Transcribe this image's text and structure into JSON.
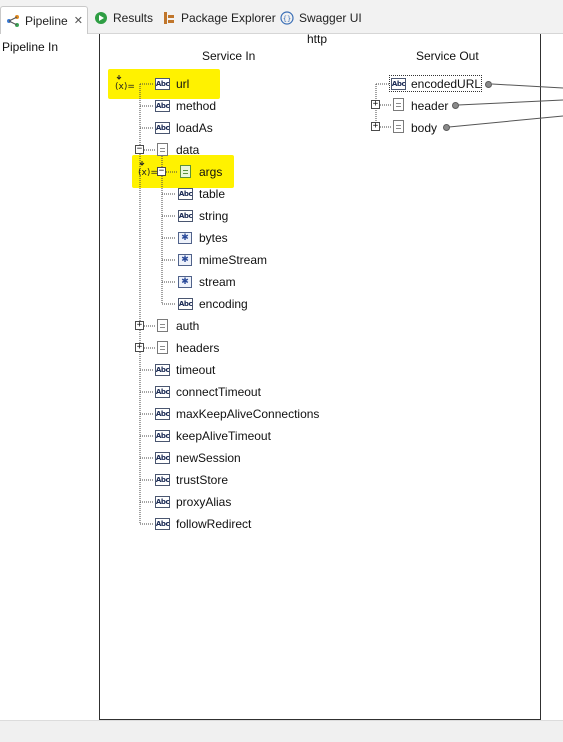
{
  "tabs": [
    {
      "label": "Pipeline",
      "icon": "pipeline-icon",
      "active": true,
      "closable": true
    },
    {
      "label": "Results",
      "icon": "results-icon",
      "active": false
    },
    {
      "label": "Package Explorer",
      "icon": "package-explorer-icon",
      "active": false
    },
    {
      "label": "Swagger UI",
      "icon": "swagger-icon",
      "active": false
    }
  ],
  "left_pane": {
    "label": "Pipeline In"
  },
  "service": {
    "name": "http",
    "in_title": "Service In",
    "out_title": "Service Out"
  },
  "service_in": [
    {
      "label": "url",
      "type": "string",
      "highlight": true,
      "mapped": true
    },
    {
      "label": "method",
      "type": "string"
    },
    {
      "label": "loadAs",
      "type": "string"
    },
    {
      "label": "data",
      "type": "document",
      "expanded": true
    },
    {
      "label": "args",
      "type": "document-green",
      "highlight": true,
      "mapped": true,
      "parent": "data",
      "expanded": false
    },
    {
      "label": "table",
      "type": "string",
      "parent": "data"
    },
    {
      "label": "string",
      "type": "string",
      "parent": "data"
    },
    {
      "label": "bytes",
      "type": "object",
      "parent": "data"
    },
    {
      "label": "mimeStream",
      "type": "object",
      "parent": "data"
    },
    {
      "label": "stream",
      "type": "object",
      "parent": "data"
    },
    {
      "label": "encoding",
      "type": "string",
      "parent": "data"
    },
    {
      "label": "auth",
      "type": "document",
      "expanded": false
    },
    {
      "label": "headers",
      "type": "document",
      "expanded": false
    },
    {
      "label": "timeout",
      "type": "string"
    },
    {
      "label": "connectTimeout",
      "type": "string"
    },
    {
      "label": "maxKeepAliveConnections",
      "type": "string"
    },
    {
      "label": "keepAliveTimeout",
      "type": "string"
    },
    {
      "label": "newSession",
      "type": "string"
    },
    {
      "label": "trustStore",
      "type": "string"
    },
    {
      "label": "proxyAlias",
      "type": "string"
    },
    {
      "label": "followRedirect",
      "type": "string"
    }
  ],
  "service_out": [
    {
      "label": "encodedURL",
      "type": "string",
      "selected": true
    },
    {
      "label": "header",
      "type": "document",
      "expanded": false
    },
    {
      "label": "body",
      "type": "document",
      "expanded": false
    }
  ],
  "icons": {
    "string": "abc-string-icon",
    "document": "document-icon",
    "object": "object-icon",
    "mapping": "map-link-icon"
  },
  "colors": {
    "highlight": "#fff200",
    "connector": "#8a8a8a"
  }
}
